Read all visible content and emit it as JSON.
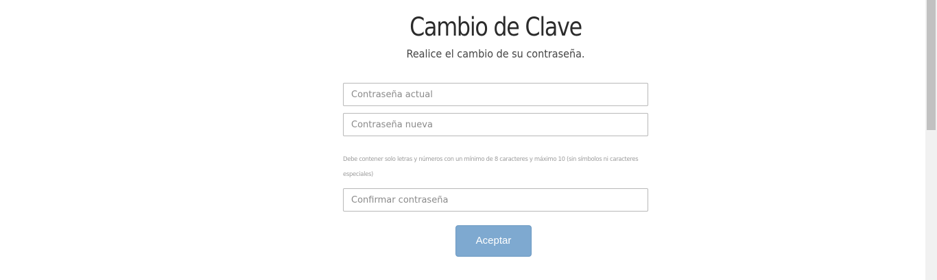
{
  "header": {
    "title": "Cambio de Clave",
    "subtitle": "Realice el cambio de su contraseña."
  },
  "form": {
    "current_password": {
      "placeholder": "Contraseña actual",
      "value": ""
    },
    "new_password": {
      "placeholder": "Contraseña nueva",
      "value": ""
    },
    "hint": "Debe contener solo letras y números con un mínimo de 8 caracteres y máximo 10 (sin símbolos ni caracteres especiales)",
    "confirm_password": {
      "placeholder": "Confirmar contraseña",
      "value": ""
    },
    "submit_label": "Aceptar"
  },
  "colors": {
    "button": "#7ea9d0",
    "title": "#2b2b2b"
  }
}
